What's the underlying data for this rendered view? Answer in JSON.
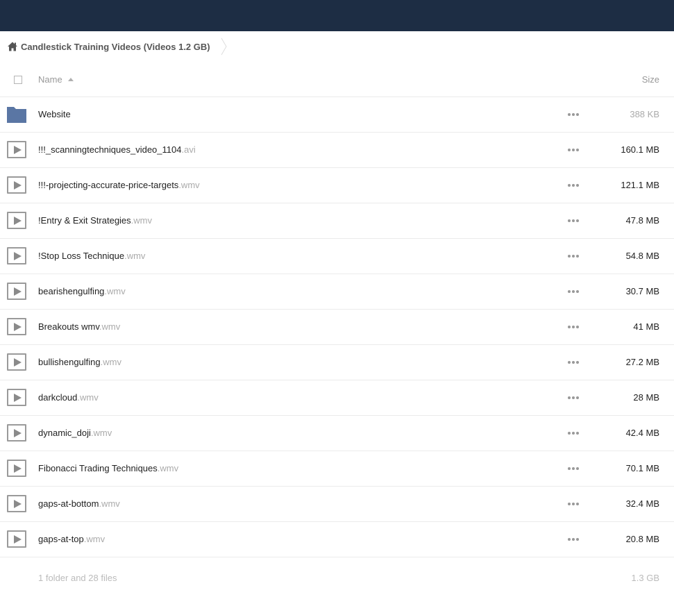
{
  "breadcrumb": {
    "home_icon": "home-icon",
    "label": "Candlestick Training Videos (Videos 1.2 GB)"
  },
  "header": {
    "name_label": "Name",
    "size_label": "Size"
  },
  "colors": {
    "topbar": "#1d2d44",
    "folder": "#5a76a4",
    "extension": "#aaaaaa"
  },
  "files": [
    {
      "type": "folder",
      "icon": "folder-icon",
      "name": "Website",
      "ext": "",
      "size": "388 KB"
    },
    {
      "type": "video",
      "icon": "play-icon",
      "name": "!!!_scanningtechniques_video_1104",
      "ext": ".avi",
      "size": "160.1 MB"
    },
    {
      "type": "video",
      "icon": "play-icon",
      "name": "!!!-projecting-accurate-price-targets",
      "ext": ".wmv",
      "size": "121.1 MB"
    },
    {
      "type": "video",
      "icon": "play-icon",
      "name": "!Entry & Exit Strategies",
      "ext": ".wmv",
      "size": "47.8 MB"
    },
    {
      "type": "video",
      "icon": "play-icon",
      "name": "!Stop Loss Technique",
      "ext": ".wmv",
      "size": "54.8 MB"
    },
    {
      "type": "video",
      "icon": "play-icon",
      "name": "bearishengulfing",
      "ext": ".wmv",
      "size": "30.7 MB"
    },
    {
      "type": "video",
      "icon": "play-icon",
      "name": "Breakouts wmv",
      "ext": ".wmv",
      "size": "41 MB"
    },
    {
      "type": "video",
      "icon": "play-icon",
      "name": "bullishengulfing",
      "ext": ".wmv",
      "size": "27.2 MB"
    },
    {
      "type": "video",
      "icon": "play-icon",
      "name": "darkcloud",
      "ext": ".wmv",
      "size": "28 MB"
    },
    {
      "type": "video",
      "icon": "play-icon",
      "name": "dynamic_doji",
      "ext": ".wmv",
      "size": "42.4 MB"
    },
    {
      "type": "video",
      "icon": "play-icon",
      "name": "Fibonacci Trading Techniques",
      "ext": ".wmv",
      "size": "70.1 MB"
    },
    {
      "type": "video",
      "icon": "play-icon",
      "name": "gaps-at-bottom",
      "ext": ".wmv",
      "size": "32.4 MB"
    },
    {
      "type": "video",
      "icon": "play-icon",
      "name": "gaps-at-top",
      "ext": ".wmv",
      "size": "20.8 MB"
    }
  ],
  "summary": {
    "count": "1 folder and 28 files",
    "total_size": "1.3 GB"
  }
}
